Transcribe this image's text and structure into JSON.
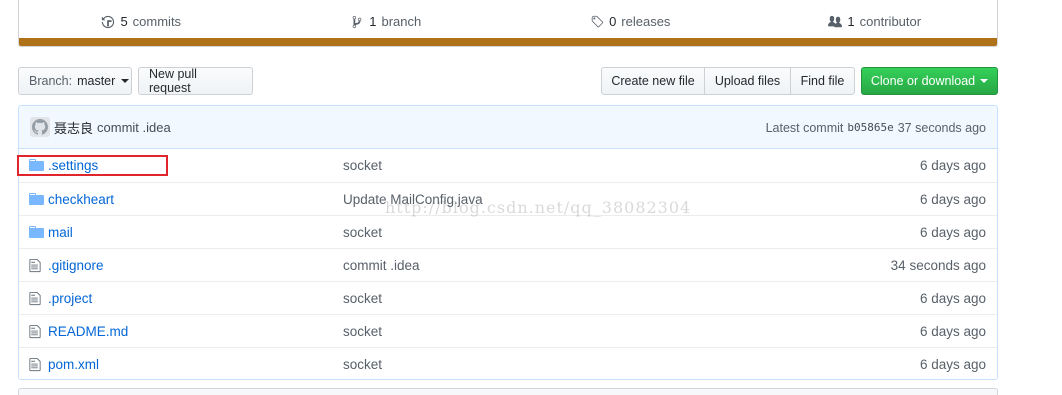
{
  "summary": {
    "commits": {
      "num": "5",
      "label": "commits",
      "icon": "history-icon"
    },
    "branches": {
      "num": "1",
      "label": "branch",
      "icon": "git-branch-icon"
    },
    "releases": {
      "num": "0",
      "label": "releases",
      "icon": "tag-icon"
    },
    "contributors": {
      "num": "1",
      "label": "contributor",
      "icon": "people-icon"
    },
    "language_color": "#b07219"
  },
  "toolbar": {
    "branch_prefix": "Branch:",
    "branch_name": "master",
    "new_pull_request": "New pull request",
    "create_new_file": "Create new file",
    "upload_files": "Upload files",
    "find_file": "Find file",
    "clone_or_download": "Clone or download",
    "clone_color": "#28a745"
  },
  "latest_commit": {
    "author": "聂志良",
    "message": "commit .idea",
    "label": "Latest commit",
    "sha": "b05865e",
    "age": "37 seconds ago"
  },
  "files": [
    {
      "type": "folder",
      "name": ".settings",
      "message": "socket",
      "age": "6 days ago"
    },
    {
      "type": "folder",
      "name": "checkheart",
      "message": "Update MailConfig.java",
      "age": "6 days ago"
    },
    {
      "type": "folder",
      "name": "mail",
      "message": "socket",
      "age": "6 days ago"
    },
    {
      "type": "file",
      "name": ".gitignore",
      "message": "commit .idea",
      "age": "34 seconds ago"
    },
    {
      "type": "file",
      "name": ".project",
      "message": "socket",
      "age": "6 days ago"
    },
    {
      "type": "file",
      "name": "README.md",
      "message": "socket",
      "age": "6 days ago"
    },
    {
      "type": "file",
      "name": "pom.xml",
      "message": "socket",
      "age": "6 days ago"
    }
  ],
  "watermark": "http://blog.csdn.net/qq_38082304",
  "colors": {
    "link": "#0366d6",
    "folder": "#79b8ff",
    "highlight": "#e0252d"
  }
}
